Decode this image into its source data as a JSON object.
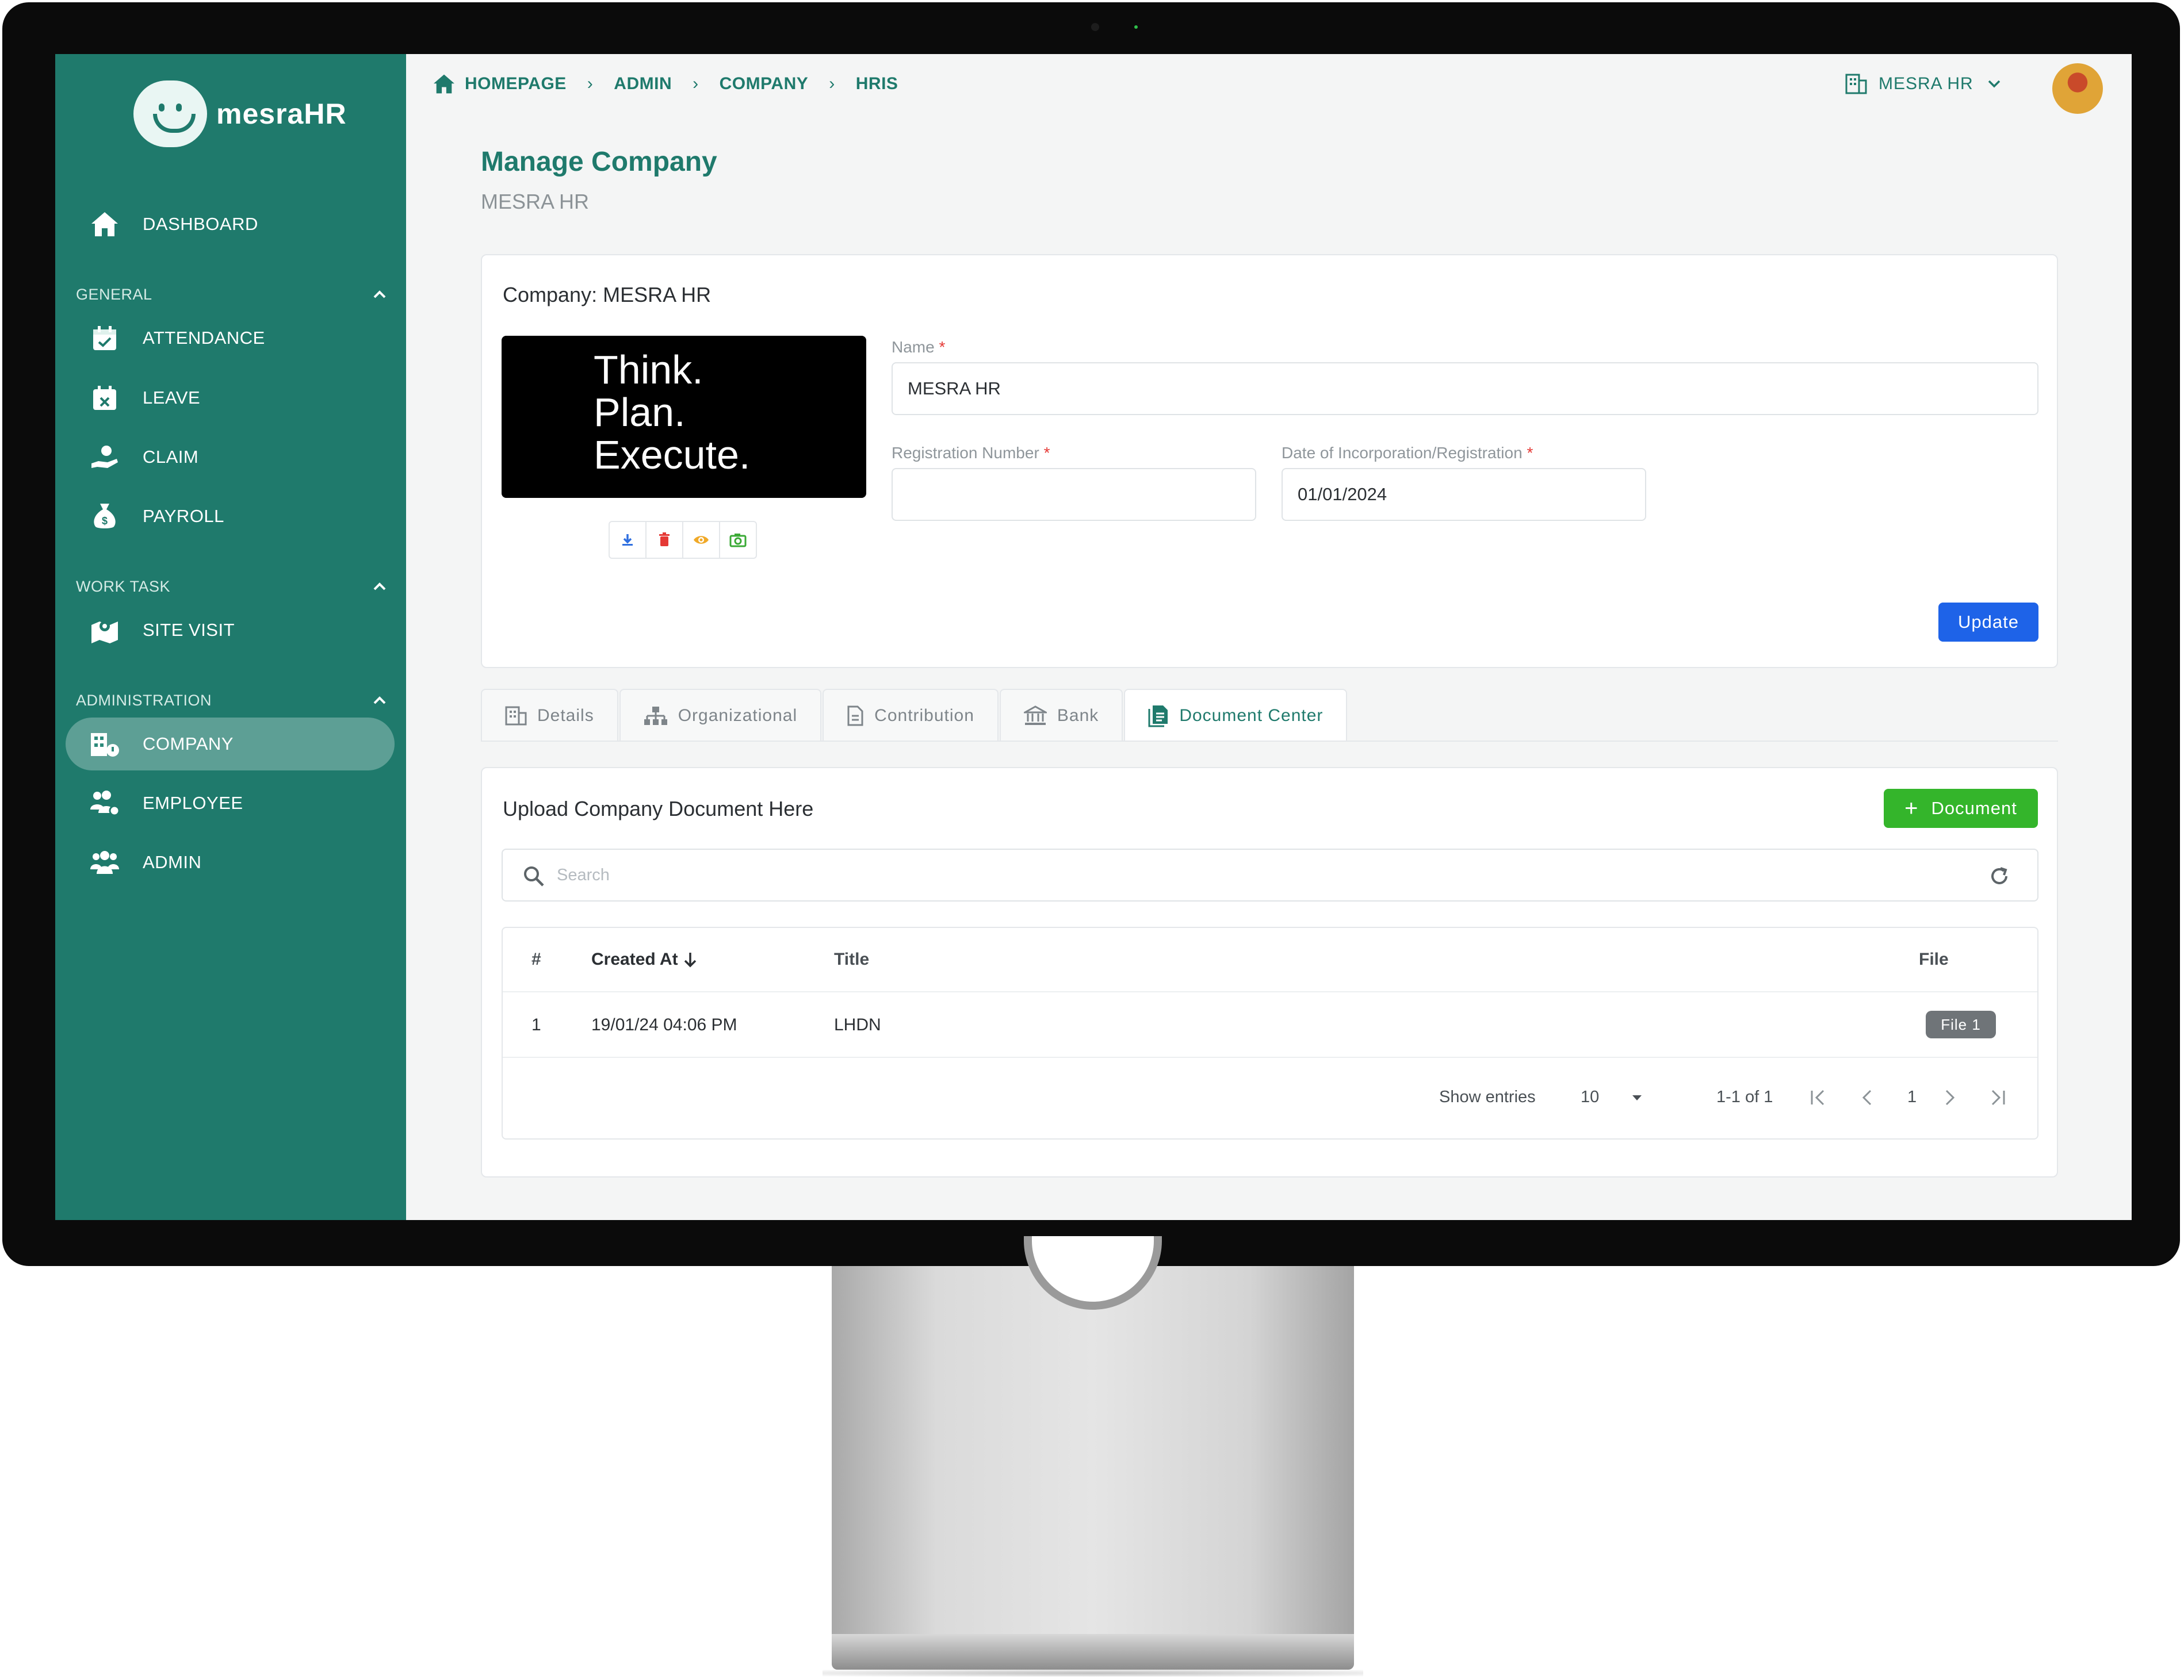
{
  "app": {
    "name": "mesraHR"
  },
  "sidebar": {
    "dashboard": "DASHBOARD",
    "sections": [
      {
        "label": "GENERAL",
        "items": [
          "ATTENDANCE",
          "LEAVE",
          "CLAIM",
          "PAYROLL"
        ]
      },
      {
        "label": "WORK TASK",
        "items": [
          "SITE VISIT"
        ]
      },
      {
        "label": "ADMINISTRATION",
        "items": [
          "COMPANY",
          "EMPLOYEE",
          "ADMIN"
        ]
      }
    ]
  },
  "breadcrumb": [
    "HOMEPAGE",
    "ADMIN",
    "COMPANY",
    "HRIS"
  ],
  "header": {
    "company_switch": "MESRA HR"
  },
  "page": {
    "title": "Manage Company",
    "subtitle": "MESRA HR"
  },
  "company_card": {
    "title": "Company: MESRA HR",
    "logo_text": [
      "Think.",
      "Plan.",
      "Execute."
    ],
    "fields": {
      "name": {
        "label": "Name",
        "required_mark": "*",
        "value": "MESRA HR"
      },
      "registration_number": {
        "label": "Registration Number",
        "required_mark": "*",
        "value": ""
      },
      "date_of_incorporation": {
        "label": "Date of Incorporation/Registration",
        "required_mark": "*",
        "value": "01/01/2024"
      }
    },
    "update_label": "Update"
  },
  "tabs": [
    {
      "label": "Details",
      "icon": "building-icon"
    },
    {
      "label": "Organizational",
      "icon": "org-chart-icon"
    },
    {
      "label": "Contribution",
      "icon": "document-icon"
    },
    {
      "label": "Bank",
      "icon": "bank-icon"
    },
    {
      "label": "Document Center",
      "icon": "document-center-icon",
      "active": true
    }
  ],
  "documents": {
    "title": "Upload Company Document Here",
    "add_label": "Document",
    "search_placeholder": "Search",
    "columns": {
      "index": "#",
      "created_at": "Created At",
      "title": "Title",
      "file": "File"
    },
    "rows": [
      {
        "index": "1",
        "created_at": "19/01/24 04:06 PM",
        "title": "LHDN",
        "file": "File 1"
      }
    ],
    "pagination": {
      "show_entries_label": "Show entries",
      "page_size": "10",
      "range": "1-1 of 1",
      "current_page": "1"
    }
  },
  "colors": {
    "primary": "#1f7a6c",
    "update_button": "#1e63e8",
    "add_button": "#34b52b",
    "required": "#e53935"
  }
}
